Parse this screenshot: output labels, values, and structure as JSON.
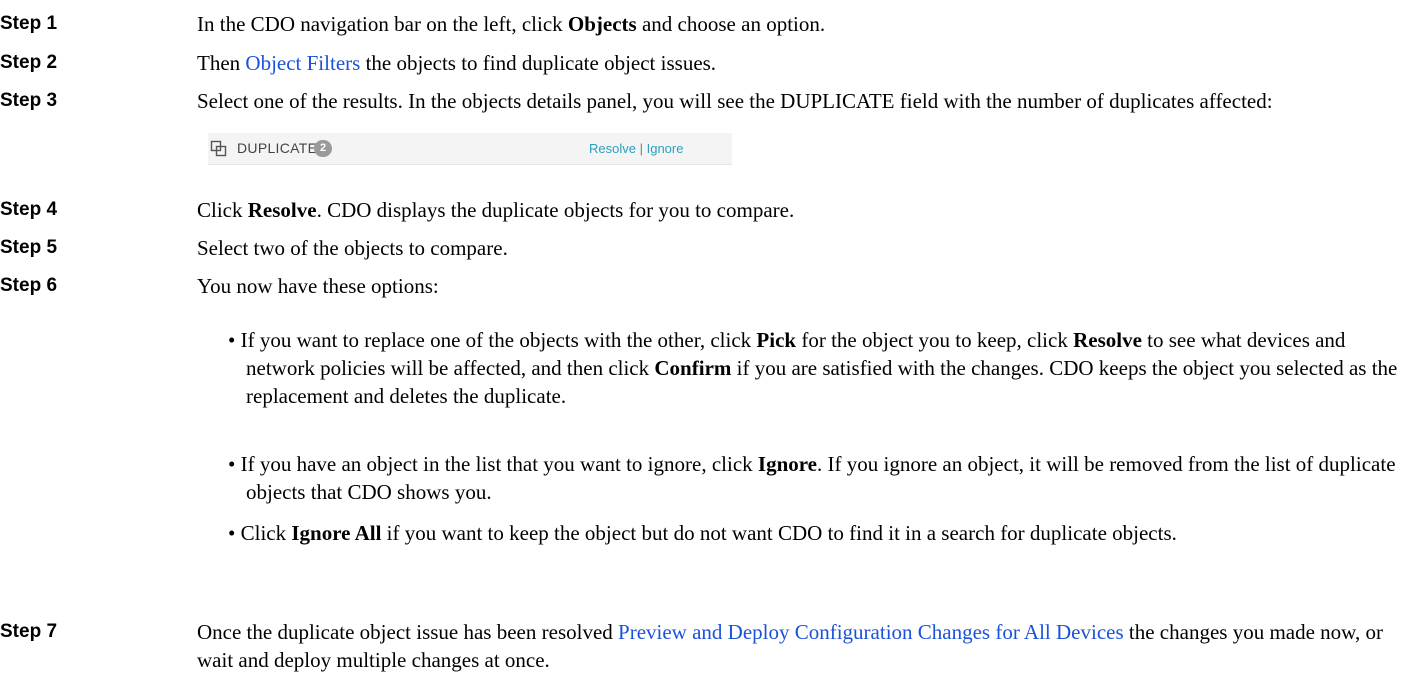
{
  "steps": [
    {
      "label": "Step 1",
      "parts": [
        "In the CDO navigation bar on the left, click ",
        "Objects",
        " and choose an option."
      ]
    },
    {
      "label": "Step 2",
      "parts": [
        "Then ",
        "Object Filters",
        " the objects to find duplicate object issues."
      ]
    },
    {
      "label": "Step 3",
      "parts": [
        "Select one of the results. In the objects details panel, you will see the DUPLICATE field with the number of duplicates affected:"
      ]
    },
    {
      "label": "Step 4",
      "parts": [
        "Click ",
        "Resolve",
        ". CDO displays the duplicate objects for you to compare."
      ]
    },
    {
      "label": "Step 5",
      "parts": [
        "Select two of the objects to compare."
      ]
    },
    {
      "label": "Step 6",
      "parts": [
        "You now have these options:"
      ]
    },
    {
      "label": "Step 7",
      "parts": [
        "Once the duplicate object issue has been resolved ",
        "Preview and Deploy Configuration Changes for All Devices",
        " the changes you made now, or wait and deploy multiple changes at once."
      ]
    }
  ],
  "duplicate_panel": {
    "icon": "duplicate-icon",
    "label": "DUPLICATE",
    "count": "2",
    "resolve": "Resolve",
    "separator": "|",
    "ignore": "Ignore"
  },
  "options": [
    {
      "bullet": "•",
      "parts": [
        "If you want to replace one of the objects with the other, click ",
        "Pick",
        " for the object you to keep, click ",
        "Resolve",
        " to see what devices and network policies will be affected, and then click ",
        "Confirm",
        " if you are satisfied with the changes. CDO keeps the object you selected as the replacement and deletes the duplicate."
      ]
    },
    {
      "bullet": "•",
      "parts": [
        "If you have an object in the list that you want to ignore, click ",
        "Ignore",
        ". If you ignore an object, it will be removed from the list of duplicate objects that CDO shows you."
      ]
    },
    {
      "bullet": "•",
      "parts": [
        "Click ",
        "Ignore All",
        " if you want to keep the object but do not want CDO to find it in a search for duplicate objects."
      ]
    }
  ],
  "colors": {
    "link": "#1a52d9",
    "panel_action": "#2a9fbf",
    "badge": "#9a9a9a"
  }
}
